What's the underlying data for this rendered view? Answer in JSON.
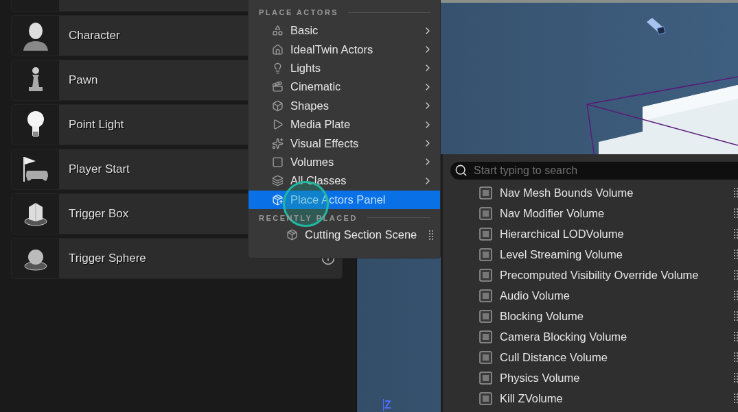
{
  "actor_list": {
    "items": [
      {
        "label": "Character"
      },
      {
        "label": "Pawn"
      },
      {
        "label": "Point Light"
      },
      {
        "label": "Player Start"
      },
      {
        "label": "Trigger Box"
      },
      {
        "label": "Trigger Sphere"
      }
    ]
  },
  "place_menu": {
    "sections": [
      {
        "title": "PLACE ACTORS",
        "items": [
          {
            "label": "Basic",
            "submenu": true,
            "selected": false
          },
          {
            "label": "IdealTwin Actors",
            "submenu": true,
            "selected": false
          },
          {
            "label": "Lights",
            "submenu": true,
            "selected": false
          },
          {
            "label": "Cinematic",
            "submenu": true,
            "selected": false
          },
          {
            "label": "Shapes",
            "submenu": true,
            "selected": false
          },
          {
            "label": "Media Plate",
            "submenu": true,
            "selected": false
          },
          {
            "label": "Visual Effects",
            "submenu": true,
            "selected": false
          },
          {
            "label": "Volumes",
            "submenu": true,
            "selected": false
          },
          {
            "label": "All Classes",
            "submenu": true,
            "selected": false
          },
          {
            "label": "Place Actors Panel",
            "submenu": false,
            "selected": true
          }
        ]
      },
      {
        "title": "RECENTLY PLACED",
        "items": [
          {
            "label": "Cutting Section Scene",
            "submenu": false,
            "selected": false,
            "draggable": true
          }
        ]
      }
    ]
  },
  "viewport": {
    "axis_label": "Z"
  },
  "volumes_menu": {
    "search": {
      "placeholder": "Start typing to search"
    },
    "items": [
      "Nav Mesh Bounds Volume",
      "Nav Modifier Volume",
      "Hierarchical LODVolume",
      "Level Streaming Volume",
      "Precomputed Visibility Override Volume",
      "Audio Volume",
      "Blocking Volume",
      "Camera Blocking Volume",
      "Cull Distance Volume",
      "Physics Volume",
      "Kill ZVolume"
    ]
  }
}
